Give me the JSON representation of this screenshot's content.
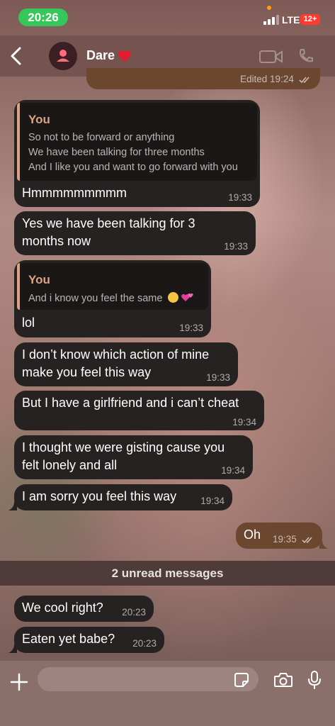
{
  "status_bar": {
    "time": "20:26",
    "network": "LTE",
    "battery": "12+"
  },
  "header": {
    "contact_name": "Dare",
    "name_emoji": "heart-icon",
    "icons": [
      "back-chevron-icon",
      "avatar-person-icon",
      "video-call-icon",
      "voice-call-icon"
    ]
  },
  "top_message": {
    "status": "Edited",
    "time": "19:24"
  },
  "messages": [
    {
      "quote": {
        "author": "You",
        "lines": [
          "So not to be forward or anything",
          "We have been talking for three months",
          "And I like you and want to go forward with you"
        ]
      },
      "text": "Hmmmmmmmmm",
      "time": "19:33"
    },
    {
      "lines": [
        "Yes we have been talking for 3",
        "months now"
      ],
      "time": "19:33"
    },
    {
      "quote": {
        "author": "You",
        "line": "And i know you feel the same"
      },
      "text": "lol",
      "time": "19:33"
    },
    {
      "lines": [
        "I don’t know which action of mine",
        "make you feel this way"
      ],
      "time": "19:33"
    },
    {
      "text": "But I have a girlfriend and i can’t cheat",
      "time": "19:34"
    },
    {
      "lines": [
        "I thought we were gisting cause you",
        "felt lonely and all"
      ],
      "time": "19:34"
    },
    {
      "text": "I am sorry you feel this way",
      "time": "19:34"
    },
    {
      "text": "Oh",
      "time": "19:35",
      "outgoing": true
    }
  ],
  "unread_label": "2 unread messages",
  "new_messages": [
    {
      "text": "We cool right?",
      "time": "20:23"
    },
    {
      "text": "Eaten yet babe?",
      "time": "20:23"
    }
  ],
  "input": {
    "placeholder": ""
  },
  "colors": {
    "incoming_bubble": "#262221",
    "outgoing_bubble": "#6b4730",
    "quote_accent": "#dca281",
    "time_pill": "#35c759",
    "battery": "#ff3b30"
  }
}
